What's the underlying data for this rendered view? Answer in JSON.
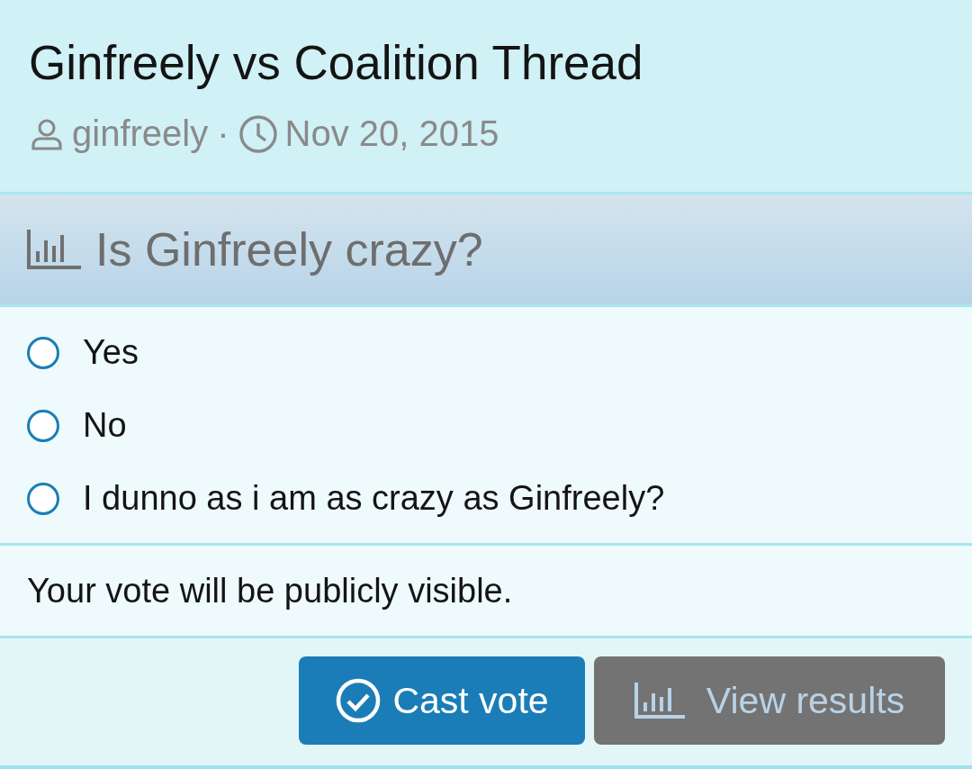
{
  "thread": {
    "title": "Ginfreely vs Coalition Thread",
    "author": "ginfreely",
    "separator": "·",
    "date": "Nov 20, 2015"
  },
  "poll": {
    "question": "Is Ginfreely crazy?",
    "options": [
      {
        "label": "Yes",
        "selected": false
      },
      {
        "label": "No",
        "selected": false
      },
      {
        "label": "I dunno as i am as crazy as Ginfreely?",
        "selected": false
      }
    ],
    "notice": "Your vote will be publicly visible.",
    "buttons": [
      {
        "label": "Cast vote",
        "kind": "primary"
      },
      {
        "label": "View results",
        "kind": "secondary"
      }
    ]
  }
}
